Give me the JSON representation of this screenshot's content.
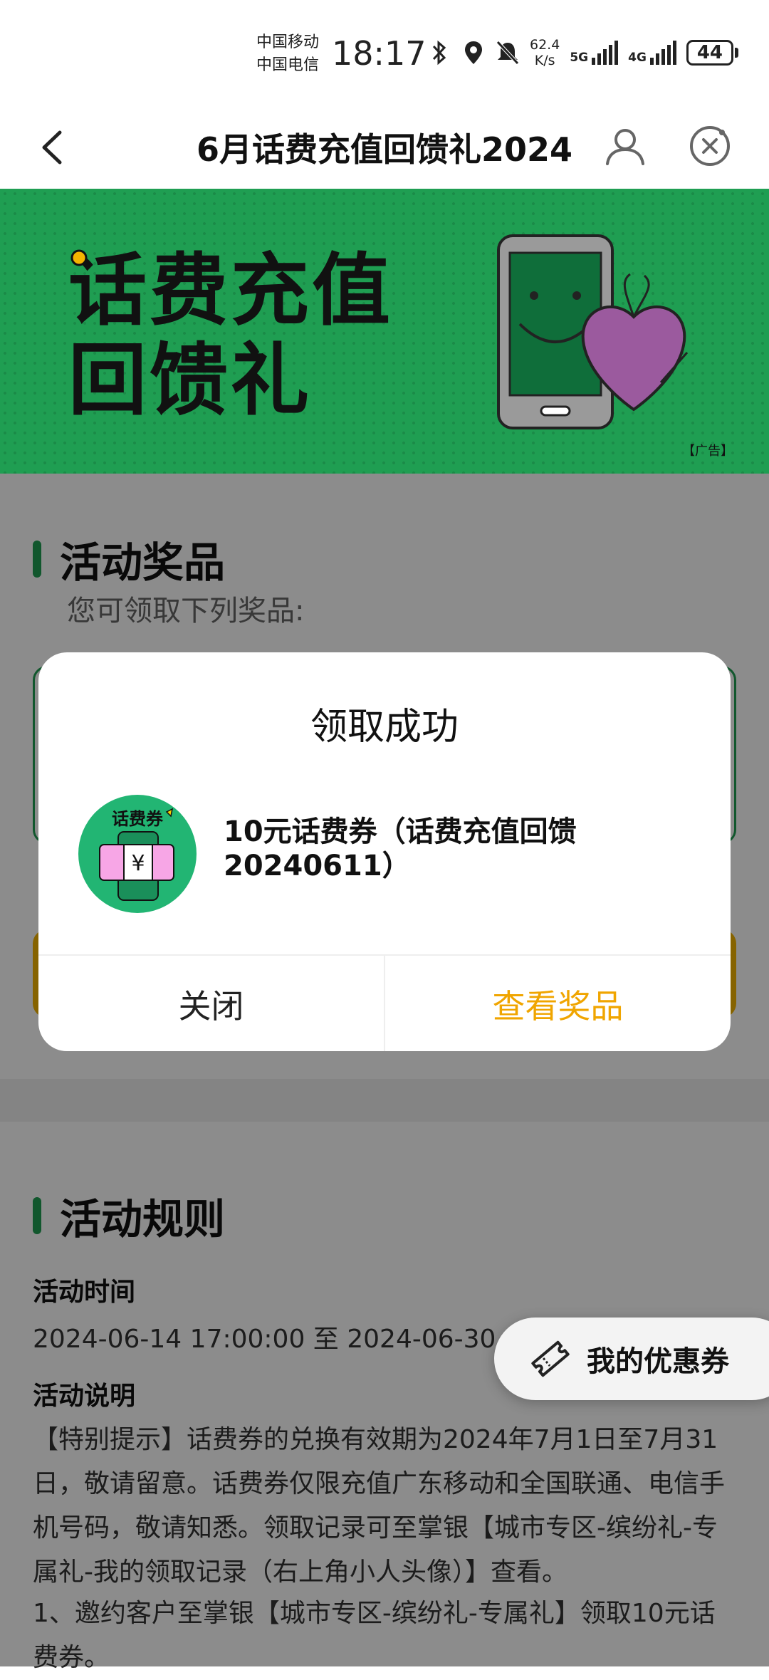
{
  "status_bar": {
    "carrier1": "中国移动",
    "carrier2": "中国电信",
    "time": "18:17",
    "net_speed_value": "62.4",
    "net_speed_unit": "K/s",
    "sig1_label": "5G",
    "sig2_label": "4G",
    "battery": "44",
    "icons": [
      "bluetooth-icon",
      "location-icon",
      "mute-bell-icon"
    ]
  },
  "nav": {
    "title": "6月话费充值回馈礼2024",
    "back_icon": "chevron-left-icon",
    "user_icon": "user-icon",
    "close_icon": "close-circle-icon"
  },
  "banner": {
    "line1": "话费充值",
    "line2": "回馈礼",
    "ad_tag": "【广告】",
    "bg_color": "#1f9e52"
  },
  "prizes_section": {
    "heading": "活动奖品",
    "subtitle": "您可领取下列奖品:"
  },
  "rules_section": {
    "heading": "活动规则",
    "time_label": "活动时间",
    "time_value": "2024-06-14 17:00:00 至 2024-06-30 2",
    "desc_label": "活动说明",
    "desc_text": "【特别提示】话费券的兑换有效期为2024年7月1日至7月31日，敬请留意。话费券仅限充值广东移动和全国联通、电信手机号码，敬请知悉。领取记录可至掌银【城市专区-缤纷礼-专属礼-我的领取记录（右上角小人头像）】查看。",
    "item1": "1、邀约客户至掌银【城市专区-缤纷礼-专属礼】领取10元话费券。"
  },
  "floating": {
    "label": "我的优惠券",
    "icon": "ticket-icon"
  },
  "dialog": {
    "title": "领取成功",
    "prize_icon_label": "话费券",
    "prize_name": "10元话费券（话费充值回馈20240611）",
    "close_label": "关闭",
    "view_label": "查看奖品",
    "accent": "#f0a500"
  }
}
